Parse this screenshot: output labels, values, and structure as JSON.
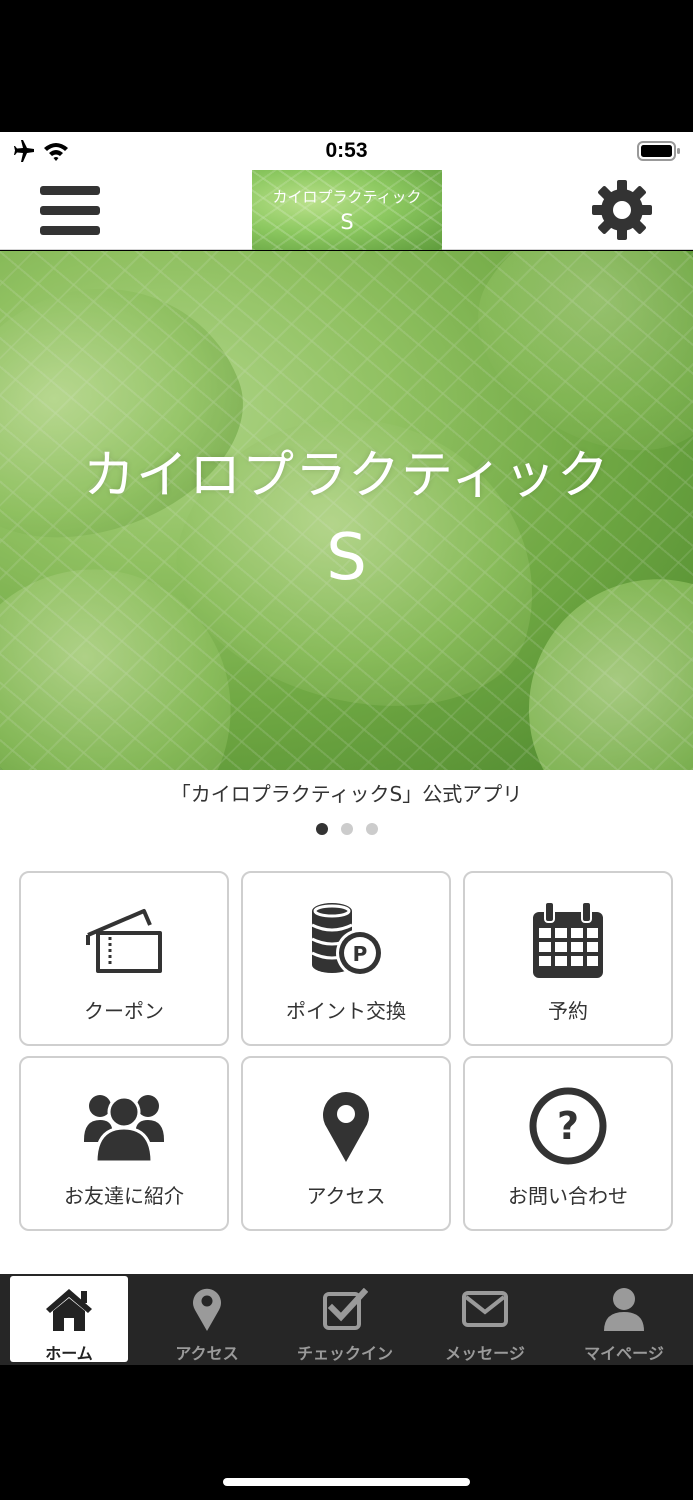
{
  "status_bar": {
    "time": "0:53",
    "icons": [
      "airplane-icon",
      "wifi-icon",
      "battery-icon"
    ]
  },
  "nav_bar": {
    "logo_line1": "カイロプラクティック",
    "logo_line2": "S",
    "menu_icon": "hamburger-icon",
    "settings_icon": "gear-icon"
  },
  "hero": {
    "title": "カイロプラクティック",
    "subtitle": "S",
    "caption": "「カイロプラクティックS」公式アプリ",
    "slides_total": 3,
    "slide_active": 1
  },
  "menu_tiles": [
    {
      "label": "クーポン",
      "icon": "ticket-icon"
    },
    {
      "label": "ポイント交換",
      "icon": "coins-icon"
    },
    {
      "label": "予約",
      "icon": "calendar-icon"
    },
    {
      "label": "お友達に紹介",
      "icon": "users-icon"
    },
    {
      "label": "アクセス",
      "icon": "map-pin-icon"
    },
    {
      "label": "お問い合わせ",
      "icon": "question-icon"
    }
  ],
  "tab_bar": [
    {
      "label": "ホーム",
      "icon": "home-icon",
      "active": true
    },
    {
      "label": "アクセス",
      "icon": "map-pin-icon",
      "active": false
    },
    {
      "label": "チェックイン",
      "icon": "checkbox-icon",
      "active": false
    },
    {
      "label": "メッセージ",
      "icon": "envelope-icon",
      "active": false
    },
    {
      "label": "マイページ",
      "icon": "user-icon",
      "active": false
    }
  ],
  "colors": {
    "tabbar_bg": "#262626",
    "icon_dark": "#333333",
    "tile_border": "#cfcfcf",
    "hero_green": "#8cc860"
  }
}
